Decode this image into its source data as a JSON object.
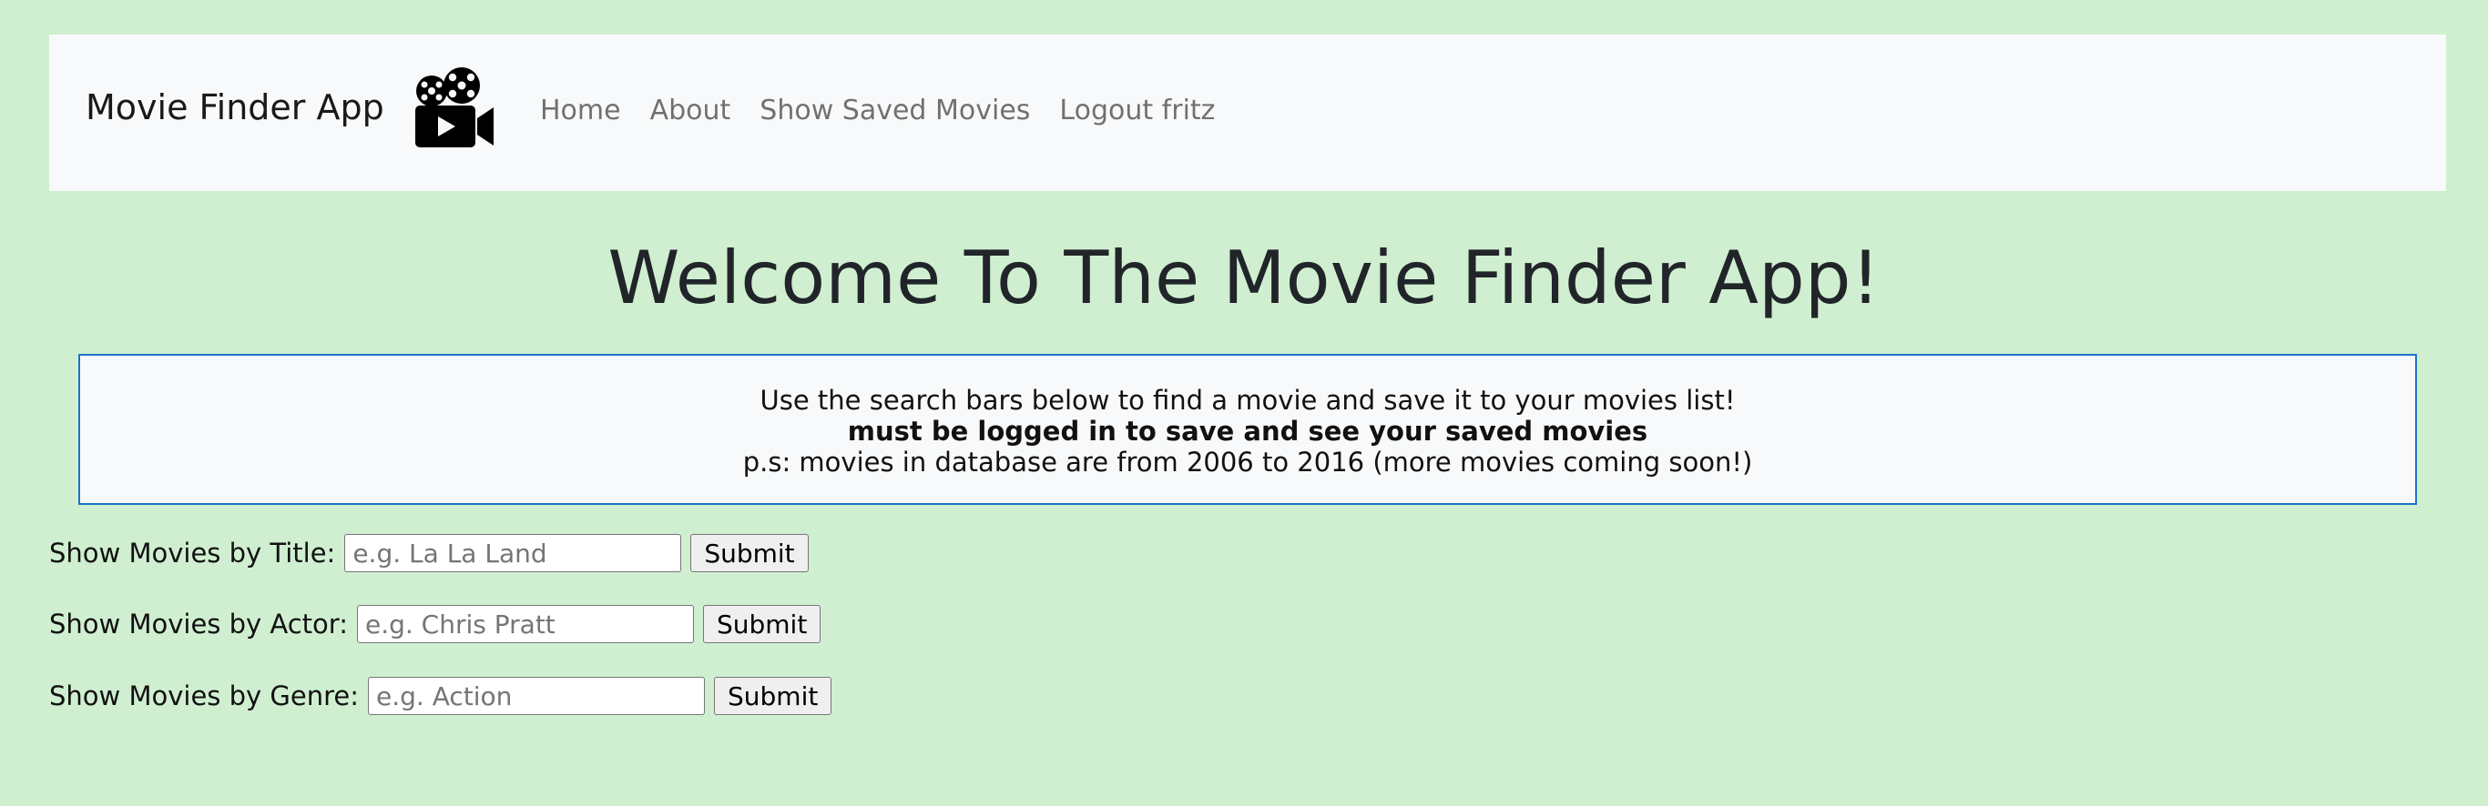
{
  "navbar": {
    "brand": "Movie Finder App",
    "brand_icon": "movie-camera-icon",
    "links": [
      "Home",
      "About",
      "Show Saved Movies",
      "Logout fritz"
    ]
  },
  "main": {
    "title": "Welcome To The Movie Finder App!",
    "info": {
      "line1": "Use the search bars below to find a movie and save it to your movies list!",
      "line2": "must be logged in to save and see your saved movies",
      "line3": "p.s: movies in database are from 2006 to 2016 (more movies coming soon!)"
    }
  },
  "forms": {
    "title": {
      "label": "Show Movies by Title:",
      "placeholder": "e.g. La La Land",
      "value": "",
      "submit": "Submit"
    },
    "actor": {
      "label": "Show Movies by Actor:",
      "placeholder": "e.g. Chris Pratt",
      "value": "",
      "submit": "Submit"
    },
    "genre": {
      "label": "Show Movies by Genre:",
      "placeholder": "e.g. Action",
      "value": "",
      "submit": "Submit"
    }
  },
  "colors": {
    "page_background": "#d0efd1",
    "navbar_background": "#f8f9fa",
    "info_border": "#1a73c7"
  }
}
